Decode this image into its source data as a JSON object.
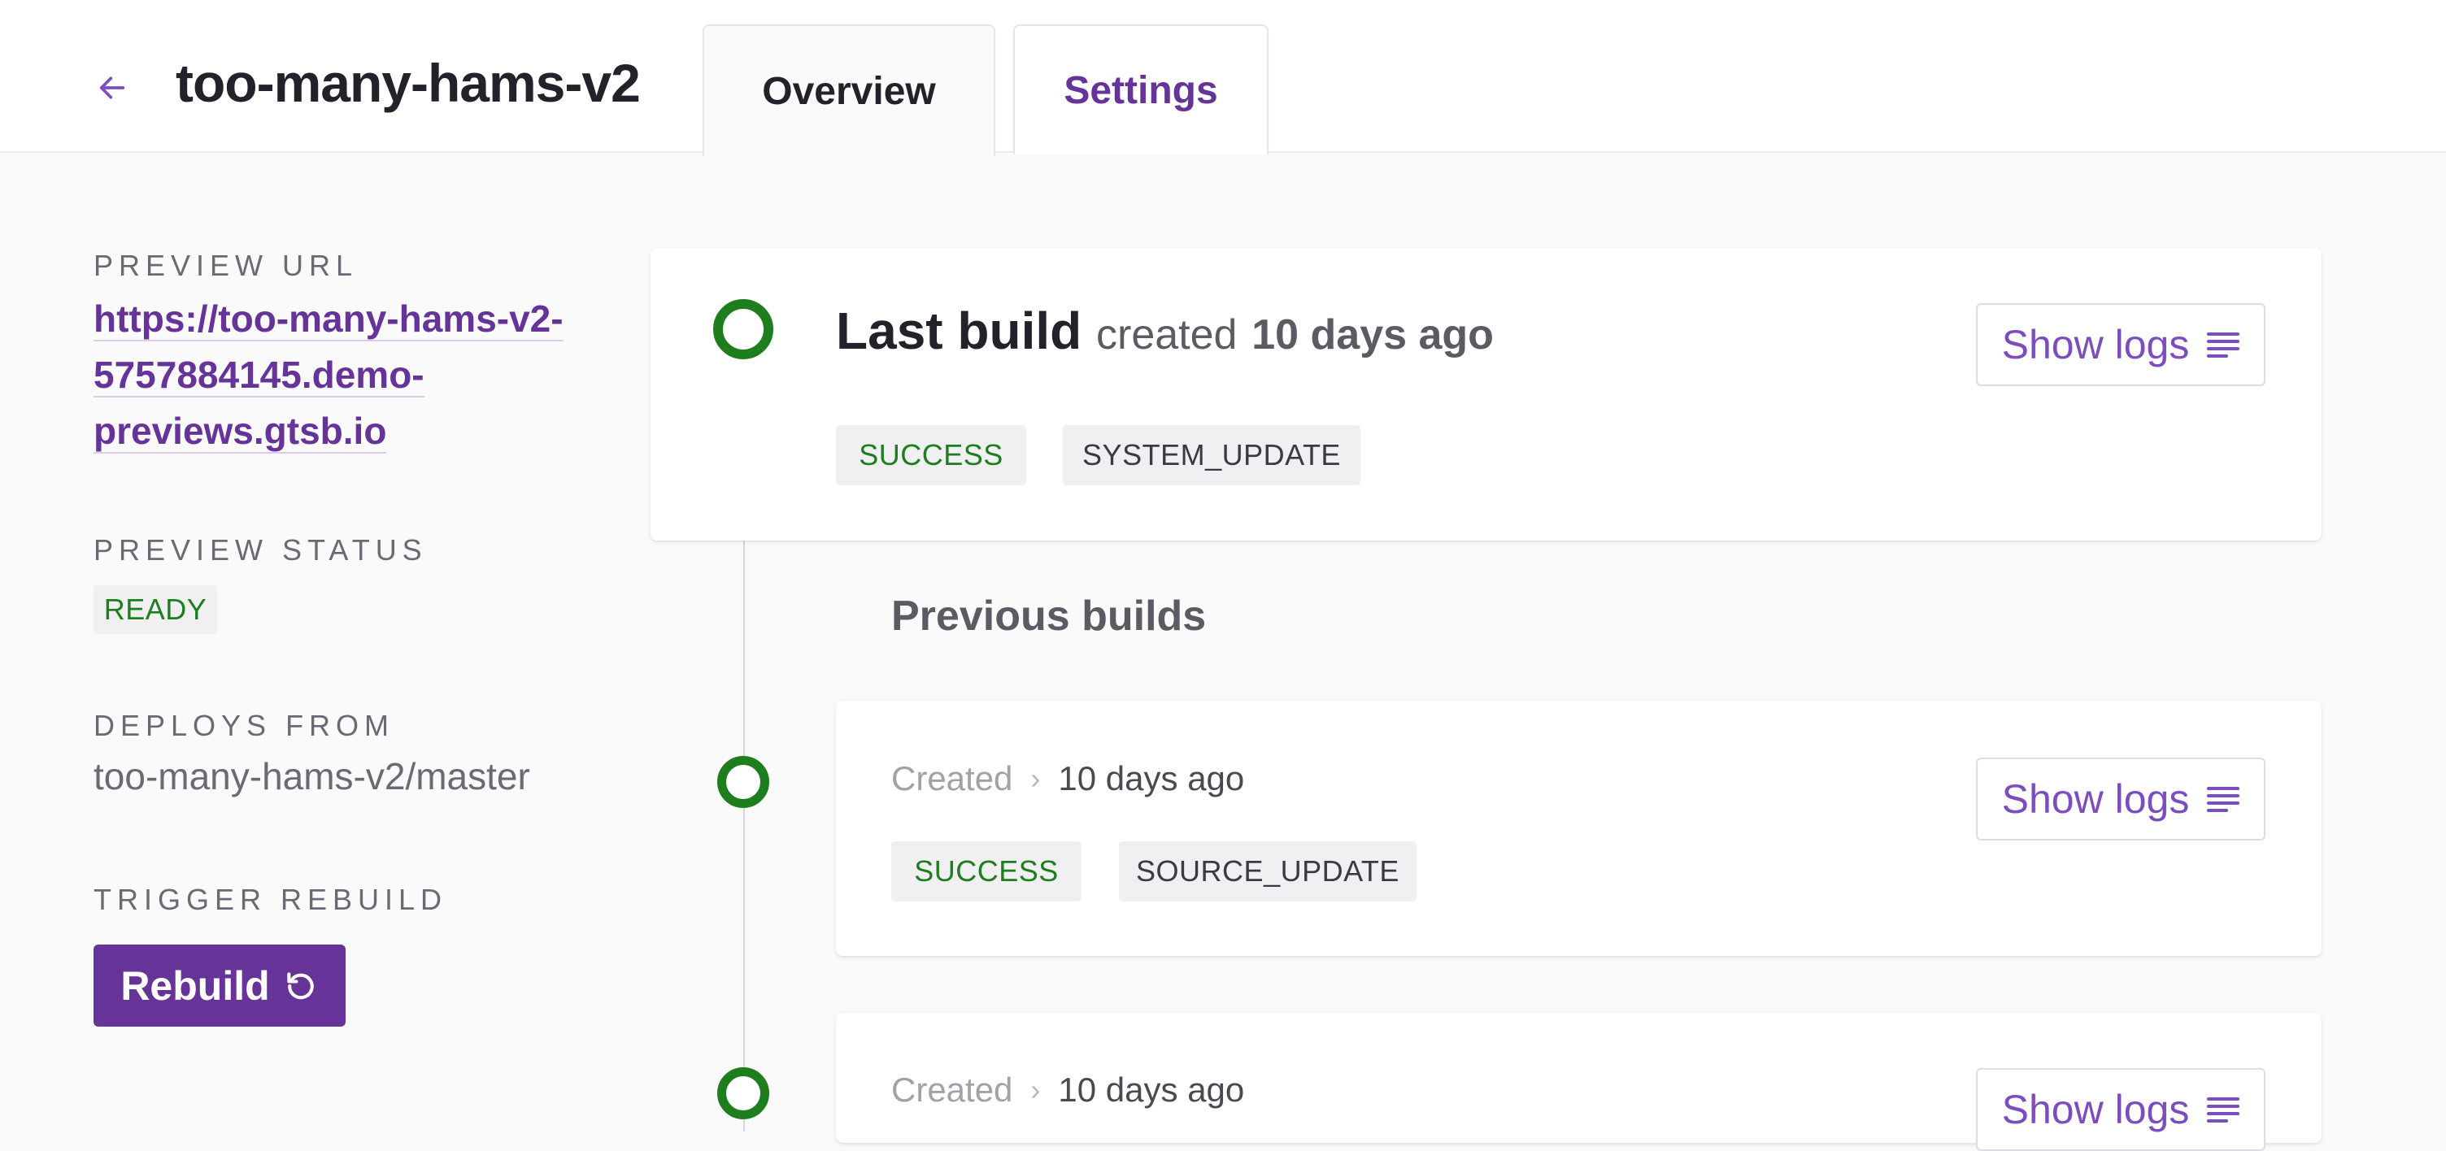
{
  "header": {
    "title": "too-many-hams-v2",
    "tabs": [
      {
        "label": "Overview",
        "active": true
      },
      {
        "label": "Settings",
        "active": false
      }
    ]
  },
  "sidebar": {
    "preview_url_label": "PREVIEW URL",
    "preview_url_lines": [
      "https://too-many-hams-v2-",
      "5757884145.demo-",
      "previews.gtsb.io"
    ],
    "preview_status_label": "PREVIEW STATUS",
    "preview_status": "READY",
    "deploys_from_label": "DEPLOYS FROM",
    "deploys_from": "too-many-hams-v2/master",
    "trigger_rebuild_label": "TRIGGER REBUILD",
    "rebuild_button": "Rebuild"
  },
  "last_build": {
    "title": "Last build",
    "created_word": "created",
    "created_ago": "10 days ago",
    "status": "SUCCESS",
    "reason": "SYSTEM_UPDATE",
    "show_logs": "Show logs"
  },
  "previous_builds": {
    "heading": "Previous builds",
    "items": [
      {
        "created_label": "Created",
        "separator": "›",
        "created_ago": "10 days ago",
        "status": "SUCCESS",
        "reason": "SOURCE_UPDATE",
        "show_logs": "Show logs"
      },
      {
        "created_label": "Created",
        "separator": "›",
        "created_ago": "10 days ago",
        "show_logs": "Show logs"
      }
    ]
  },
  "colors": {
    "brand": "#663399",
    "success": "#1e7e1e",
    "link": "#7c4dbf"
  },
  "icons": {
    "back": "arrow-left-icon",
    "rebuild": "refresh-icon",
    "logs": "lines-icon",
    "build_status": "ring-icon"
  }
}
